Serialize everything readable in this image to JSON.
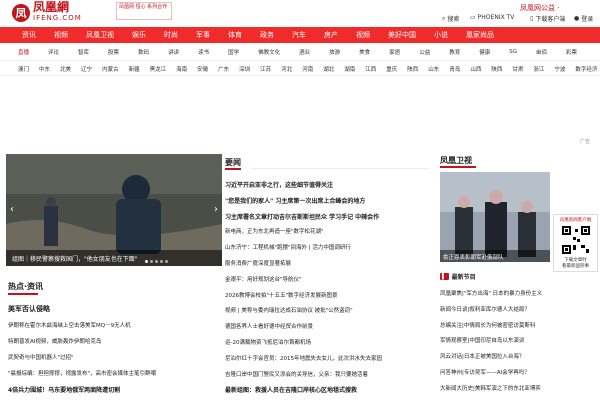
{
  "logo": {
    "mark": "凤",
    "name": "凤凰網",
    "domain": "IFENG.COM"
  },
  "top_ad": {
    "text": "凤凰网 恒心 系列合作"
  },
  "top_right": {
    "red": "凤凰网公益 ·",
    "search": "搜索",
    "phoenix_tv": "PHOENIX TV",
    "download": "下载客户端",
    "login": "登录"
  },
  "nav_main": [
    "资讯",
    "视频",
    "凤凰卫视",
    "娱乐",
    "时尚",
    "军事",
    "体育",
    "政务",
    "汽车",
    "房产",
    "视频",
    "美好中国",
    "小说",
    "凰家尚品"
  ],
  "nav_sub": [
    "直播",
    "评论",
    "智库",
    "股票",
    "数码",
    "讲讲",
    "读书",
    "国学",
    "佛教文化",
    "酒业",
    "旅游",
    "美食",
    "家居",
    "公益",
    "教育",
    "健康",
    "SG",
    "亩佰",
    "彩票"
  ],
  "nav_city": [
    "澳门",
    "中东",
    "北美",
    "辽宁",
    "内蒙古",
    "新疆",
    "黑龙江",
    "海南",
    "安徽",
    "广东",
    "深圳",
    "江苏",
    "河北",
    "河南",
    "湖北",
    "湖南",
    "江西",
    "重庆",
    "陕西",
    "山东",
    "青岛",
    "山西",
    "陕西",
    "甘肃",
    "浙江",
    "宁波",
    "数字经济"
  ],
  "ad_label": "广告",
  "slide": {
    "caption": "组图｜移民警察搜救国门，\"他女朋友也在下面\"",
    "dots": 5
  },
  "hot": {
    "title": "热点·资讯",
    "subtitle": "美军否认侵略",
    "items": [
      "伊朗称在霍尔木兹海峡上空击落美军MQ－9无人机",
      "特朗普发AI视频，威胁轰炸伊朗哈克岛",
      "武契奇与中国机器人\"过招\"",
      "\"晨报综编：担担撑撑，视露发布\"，高市密会媒体主笔引群嘲",
      "4倍兵力围城！乌东要地俄军两面降遭切割"
    ]
  },
  "important": {
    "title": "要闻",
    "items": [
      {
        "t": "习近平开启亚非之行，这些细节值得关注",
        "b": true
      },
      {
        "t": "\"您是我们的家人\" 习主席第一次出席上合峰会的地方",
        "b": true
      },
      {
        "t": "习主席署名文章打动吉尔吉斯斯坦民众  学习手记  中辣会作",
        "b": true
      },
      {
        "t": "新电商，正为东北再造一座\"数字松花湖\"",
        "b": false
      },
      {
        "t": "山东济宁：工程机械\"跑摆\"间海外 | 活力中国调研行",
        "b": false
      },
      {
        "t": "服务消费广度深度显著拓展",
        "b": false
      },
      {
        "t": "金艰平：用好规划这台\"导航仪\"",
        "b": false
      },
      {
        "t": "2026教博会校拍\"十五五\"数字经济发展新图景",
        "b": false
      },
      {
        "t": "视频 | 美称与委内瑞拉达成石油协议 被批\"公然盗窃\"",
        "b": false
      },
      {
        "t": "德国各界人士看好德中经贸合作前景",
        "b": false
      },
      {
        "t": "运-20满载物资飞抵尼泊尔首都机场",
        "b": false
      },
      {
        "t": "尼泊尔红十字会官员：2015年地震失去女儿，此次洪水失去家园",
        "b": false
      },
      {
        "t": "吉隆口岸中国门警民又添会的关导信，父亲：我只要她活着",
        "b": false
      },
      {
        "t": "最新组图：救援人员在吉隆口岸核心区地毯式搜救",
        "b": true
      }
    ]
  },
  "fenghuang": {
    "title": "凤凰卫视",
    "img_caption": "俞正恩表彰朝军赴俄部队",
    "qr": {
      "top": "凤凰新闻客户端",
      "l1": "下载文章时",
      "l2": "看最新国际事"
    },
    "hot_label": "最新节目",
    "items": [
      "凤凰聚焦|\"军方出海\" 日本的暴力身份主义",
      "新闻今日谈|叙利亚库尔德人大结局？",
      "总编关注|中情局长为何被密密访莫斯科",
      "军情观察室|中国印尼自岛以东演训",
      "风云对话|日本正被美国拉入台海？",
      "问答神州|专访吴军——AI会学再吗？",
      "大新闻大历史|美韩军演之下的东北亚博弈"
    ]
  }
}
